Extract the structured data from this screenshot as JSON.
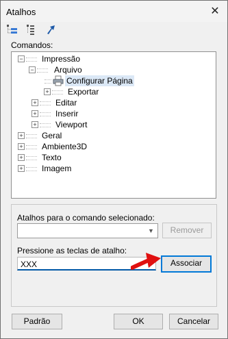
{
  "window": {
    "title": "Atalhos"
  },
  "labels": {
    "commands": "Comandos:",
    "shortcuts_for_command": "Atalhos para o comando selecionado:",
    "press_keys": "Pressione as teclas de atalho:"
  },
  "tree": {
    "items": [
      {
        "label": "Impressão",
        "expander": "−"
      },
      {
        "label": "Arquivo",
        "expander": "−"
      },
      {
        "label": "Configurar Página",
        "expander": "",
        "selected": true
      },
      {
        "label": "Exportar",
        "expander": "+"
      },
      {
        "label": "Editar",
        "expander": "+"
      },
      {
        "label": "Inserir",
        "expander": "+"
      },
      {
        "label": "Viewport",
        "expander": "+"
      },
      {
        "label": "Geral",
        "expander": "+"
      },
      {
        "label": "Ambiente3D",
        "expander": "+"
      },
      {
        "label": "Texto",
        "expander": "+"
      },
      {
        "label": "Imagem",
        "expander": "+"
      }
    ]
  },
  "shortcut_combo": {
    "value": ""
  },
  "key_input": {
    "value": "XXX"
  },
  "buttons": {
    "remove": "Remover",
    "assign": "Associar",
    "default": "Padrão",
    "ok": "OK",
    "cancel": "Cancelar"
  },
  "icons": {
    "close": "close-icon",
    "expand_all": "expand-tree-icon",
    "collapse_all": "collapse-tree-icon",
    "goto": "arrow-icon",
    "annotation": "red-arrow-annotation"
  },
  "colors": {
    "accent": "#0078d7",
    "annotation": "#e01010"
  }
}
